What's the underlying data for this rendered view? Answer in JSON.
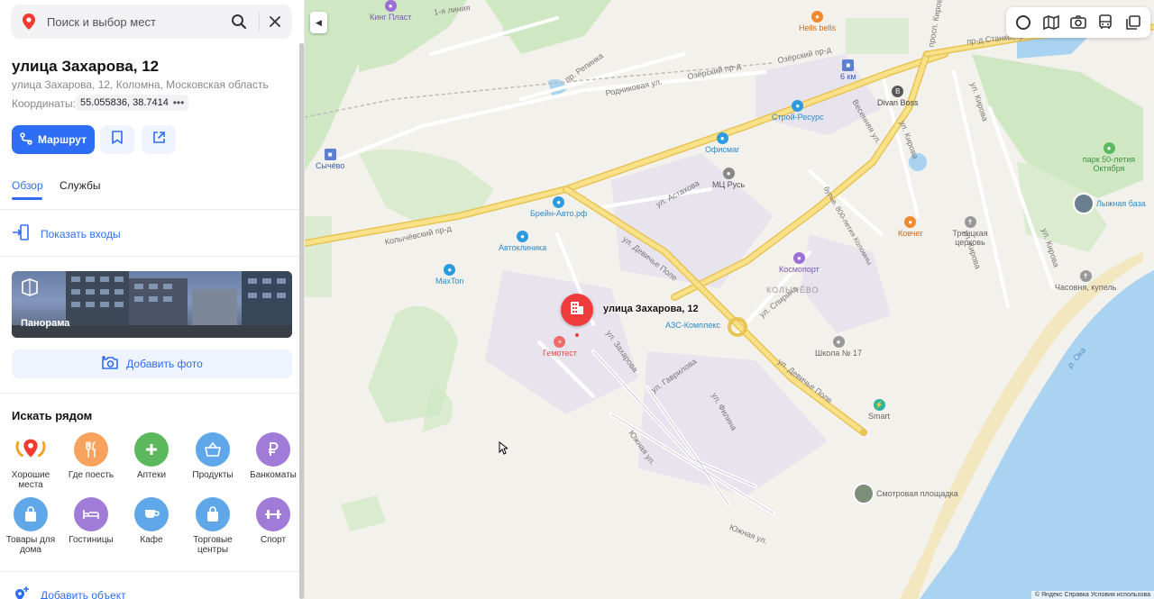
{
  "search": {
    "placeholder": "Поиск и выбор мест"
  },
  "place": {
    "title": "улица Захарова, 12",
    "address": "улица Захарова, 12, Коломна, Московская область",
    "coords_label": "Координаты:",
    "coords_value": "55.055836, 38.741473",
    "coords_more": "•••"
  },
  "actions": {
    "route_label": "Маршрут"
  },
  "tabs": [
    {
      "label": "Обзор"
    },
    {
      "label": "Службы"
    }
  ],
  "entrances_label": "Показать входы",
  "panorama_label": "Панорама",
  "add_photo_label": "Добавить фото",
  "nearby": {
    "title": "Искать рядом",
    "categories": [
      {
        "label": "Хорошие места",
        "icon": "star-pin-icon",
        "color": "#f28c28"
      },
      {
        "label": "Где поесть",
        "icon": "fork-knife-icon",
        "color": "#f7a25d"
      },
      {
        "label": "Аптеки",
        "icon": "plus-icon",
        "color": "#5cb85c"
      },
      {
        "label": "Продукты",
        "icon": "basket-icon",
        "color": "#5fa7e8"
      },
      {
        "label": "Банкоматы",
        "icon": "ruble-icon",
        "color": "#a07bd8"
      },
      {
        "label": "Товары для дома",
        "icon": "bag-icon",
        "color": "#5fa7e8"
      },
      {
        "label": "Гостиницы",
        "icon": "bed-icon",
        "color": "#a07bd8"
      },
      {
        "label": "Кафе",
        "icon": "cup-icon",
        "color": "#5fa7e8"
      },
      {
        "label": "Торговые центры",
        "icon": "bag-icon",
        "color": "#5fa7e8"
      },
      {
        "label": "Спорт",
        "icon": "dumbbell-icon",
        "color": "#a07bd8"
      }
    ]
  },
  "add_object_label": "Добавить объект",
  "map": {
    "marker_label": "улица Захарова, 12",
    "pois": [
      {
        "label": "Кинг Пласт",
        "color": "#9b6fd6",
        "text_color": "#7a55b8",
        "icon": "shop-icon"
      },
      {
        "label": "Hells bells",
        "color": "#f08a2c",
        "text_color": "#d06a10",
        "icon": "food-icon"
      },
      {
        "label": "6 км",
        "color": "#5c7fd0",
        "text_color": "#3c5fb0",
        "icon": "bus-stop-icon"
      },
      {
        "label": "Divan Boss",
        "color": "#555555",
        "text_color": "#444444",
        "icon": "store-icon"
      },
      {
        "label": "Строй-Ресурс",
        "color": "#2d9be0",
        "text_color": "#2d8ac8",
        "icon": "tools-icon"
      },
      {
        "label": "Офисмаг",
        "color": "#2d9be0",
        "text_color": "#2d8ac8",
        "icon": "store-icon"
      },
      {
        "label": "МЦ Русь",
        "color": "#888888",
        "text_color": "#555555",
        "icon": "building-icon"
      },
      {
        "label": "Сычёво",
        "color": "#5c7fd0",
        "text_color": "#3c5fb0",
        "icon": "bus-stop-icon"
      },
      {
        "label": "Брейн-Авто.рф",
        "color": "#2d9be0",
        "text_color": "#2d8ac8",
        "icon": "car-icon"
      },
      {
        "label": "Автоклиника",
        "color": "#2d9be0",
        "text_color": "#2d8ac8",
        "icon": "car-icon"
      },
      {
        "label": "MaxTon",
        "color": "#2d9be0",
        "text_color": "#2d8ac8",
        "icon": "car-icon"
      },
      {
        "label": "Ковчег",
        "color": "#f08a2c",
        "text_color": "#d06a10",
        "icon": "food-icon"
      },
      {
        "label": "Космопорт",
        "color": "#9b6fd6",
        "text_color": "#7a55b8",
        "icon": "shop-icon"
      },
      {
        "label": "Троицкая церковь",
        "color": "#999999",
        "text_color": "#666666",
        "icon": "church-icon"
      },
      {
        "label": "парк 50-летия Октября",
        "color": "#5cb85c",
        "text_color": "#3f8f3f",
        "icon": "park-icon"
      },
      {
        "label": "Лыжная база",
        "color": "#888888",
        "text_color": "#2d8ac8",
        "icon": "photo-icon"
      },
      {
        "label": "Часовня, купель",
        "color": "#999999",
        "text_color": "#666666",
        "icon": "church-icon"
      },
      {
        "label": "Гемотест",
        "color": "#f06a6a",
        "text_color": "#e04848",
        "icon": "medical-icon"
      },
      {
        "label": "АЗС-Комплекс",
        "color": "#2d9be0",
        "text_color": "#2d8ac8",
        "icon": "fuel-icon"
      },
      {
        "label": "Школа № 17",
        "color": "#999999",
        "text_color": "#666666",
        "icon": "school-icon"
      },
      {
        "label": "Smart",
        "color": "#2bb5a0",
        "text_color": "#666666",
        "icon": "charge-icon"
      },
      {
        "label": "Смотровая площадка",
        "color": "#888888",
        "text_color": "#666666",
        "icon": "photo-icon"
      }
    ],
    "streets": [
      "1-я линия",
      "пр. Репинка",
      "Родниковая ул.",
      "Озёрский пр-д",
      "Озёрский пр-д",
      "ул. Астахова",
      "Колычёвский пр-д",
      "ул. Девичье Поле",
      "ул. Спирина",
      "ул. Захарова",
      "ул. Гаврилова",
      "ул. Филина",
      "Южная ул.",
      "Южная ул.",
      "ул. Девичье Поле",
      "Весенняя ул.",
      "ул. Кирова",
      "ул. Кирова",
      "ул. Кирова",
      "пр-д Станкостроителей",
      "просп. Кирова",
      "КОЛЫЧЁВО",
      "р. Ока",
      "бульв. 800-летия Коломны",
      "ул. Кирова"
    ],
    "attribution": "© Яндекс   Справка   Условия использова"
  }
}
